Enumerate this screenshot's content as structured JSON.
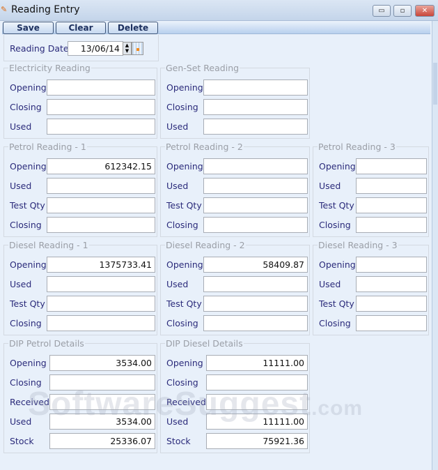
{
  "window": {
    "title": "Reading Entry",
    "minimize": "▭",
    "maximize": "▫",
    "close": "✕"
  },
  "toolbar": {
    "save": "Save",
    "clear": "Clear",
    "delete": "Delete"
  },
  "reading_date": {
    "label": "Reading Date",
    "value": "13/06/14"
  },
  "groups": [
    {
      "id": "electricity",
      "title": "Electricity Reading",
      "col": 0,
      "row": 0,
      "fields": [
        {
          "label": "Opening",
          "value": ""
        },
        {
          "label": "Closing",
          "value": ""
        },
        {
          "label": "Used",
          "value": ""
        }
      ]
    },
    {
      "id": "genset",
      "title": "Gen-Set Reading",
      "col": 1,
      "row": 0,
      "fields": [
        {
          "label": "Opening",
          "value": ""
        },
        {
          "label": "Closing",
          "value": ""
        },
        {
          "label": "Used",
          "value": ""
        }
      ]
    },
    {
      "id": "petrol-1",
      "title": "Petrol Reading - 1",
      "col": 0,
      "row": 1,
      "fields": [
        {
          "label": "Opening",
          "value": "612342.15"
        },
        {
          "label": "Used",
          "value": ""
        },
        {
          "label": "Test Qty",
          "value": ""
        },
        {
          "label": "Closing",
          "value": ""
        }
      ]
    },
    {
      "id": "petrol-2",
      "title": "Petrol Reading - 2",
      "col": 1,
      "row": 1,
      "fields": [
        {
          "label": "Opening",
          "value": ""
        },
        {
          "label": "Used",
          "value": ""
        },
        {
          "label": "Test Qty",
          "value": ""
        },
        {
          "label": "Closing",
          "value": ""
        }
      ]
    },
    {
      "id": "petrol-3",
      "title": "Petrol Reading - 3",
      "col": 2,
      "row": 1,
      "fields": [
        {
          "label": "Opening",
          "value": ""
        },
        {
          "label": "Used",
          "value": ""
        },
        {
          "label": "Test Qty",
          "value": ""
        },
        {
          "label": "Closing",
          "value": ""
        }
      ]
    },
    {
      "id": "diesel-1",
      "title": "Diesel Reading - 1",
      "col": 0,
      "row": 2,
      "fields": [
        {
          "label": "Opening",
          "value": "1375733.41"
        },
        {
          "label": "Used",
          "value": ""
        },
        {
          "label": "Test Qty",
          "value": ""
        },
        {
          "label": "Closing",
          "value": ""
        }
      ]
    },
    {
      "id": "diesel-2",
      "title": "Diesel Reading - 2",
      "col": 1,
      "row": 2,
      "fields": [
        {
          "label": "Opening",
          "value": "58409.87"
        },
        {
          "label": "Used",
          "value": ""
        },
        {
          "label": "Test Qty",
          "value": ""
        },
        {
          "label": "Closing",
          "value": ""
        }
      ]
    },
    {
      "id": "diesel-3",
      "title": "Diesel Reading - 3",
      "col": 2,
      "row": 2,
      "fields": [
        {
          "label": "Opening",
          "value": ""
        },
        {
          "label": "Used",
          "value": ""
        },
        {
          "label": "Test Qty",
          "value": ""
        },
        {
          "label": "Closing",
          "value": ""
        }
      ]
    },
    {
      "id": "dip-petrol",
      "title": "DIP Petrol Details",
      "col": 0,
      "row": 3,
      "dip": true,
      "fields": [
        {
          "label": "Opening",
          "value": "3534.00"
        },
        {
          "label": "Closing",
          "value": ""
        },
        {
          "label": "Received",
          "value": ""
        },
        {
          "label": "Used",
          "value": "3534.00"
        },
        {
          "label": "Stock",
          "value": "25336.07"
        }
      ]
    },
    {
      "id": "dip-diesel",
      "title": "DIP Diesel Details",
      "col": 1,
      "row": 3,
      "dip": true,
      "fields": [
        {
          "label": "Opening",
          "value": "11111.00"
        },
        {
          "label": "Closing",
          "value": ""
        },
        {
          "label": "Received",
          "value": ""
        },
        {
          "label": "Used",
          "value": "11111.00"
        },
        {
          "label": "Stock",
          "value": "75921.36"
        }
      ]
    }
  ],
  "watermark": {
    "main": "SoftwareSuggest",
    "suffix": ".com"
  }
}
